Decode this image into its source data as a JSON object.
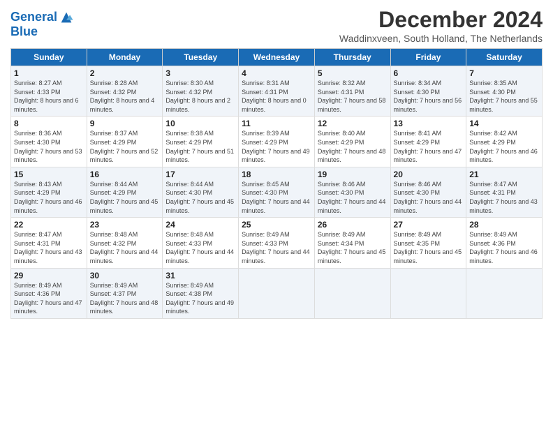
{
  "header": {
    "logo_line1": "General",
    "logo_line2": "Blue",
    "title": "December 2024",
    "subtitle": "Waddinxveen, South Holland, The Netherlands"
  },
  "columns": [
    "Sunday",
    "Monday",
    "Tuesday",
    "Wednesday",
    "Thursday",
    "Friday",
    "Saturday"
  ],
  "weeks": [
    [
      {
        "day": "1",
        "rise": "Sunrise: 8:27 AM",
        "set": "Sunset: 4:33 PM",
        "daylight": "Daylight: 8 hours and 6 minutes."
      },
      {
        "day": "2",
        "rise": "Sunrise: 8:28 AM",
        "set": "Sunset: 4:32 PM",
        "daylight": "Daylight: 8 hours and 4 minutes."
      },
      {
        "day": "3",
        "rise": "Sunrise: 8:30 AM",
        "set": "Sunset: 4:32 PM",
        "daylight": "Daylight: 8 hours and 2 minutes."
      },
      {
        "day": "4",
        "rise": "Sunrise: 8:31 AM",
        "set": "Sunset: 4:31 PM",
        "daylight": "Daylight: 8 hours and 0 minutes."
      },
      {
        "day": "5",
        "rise": "Sunrise: 8:32 AM",
        "set": "Sunset: 4:31 PM",
        "daylight": "Daylight: 7 hours and 58 minutes."
      },
      {
        "day": "6",
        "rise": "Sunrise: 8:34 AM",
        "set": "Sunset: 4:30 PM",
        "daylight": "Daylight: 7 hours and 56 minutes."
      },
      {
        "day": "7",
        "rise": "Sunrise: 8:35 AM",
        "set": "Sunset: 4:30 PM",
        "daylight": "Daylight: 7 hours and 55 minutes."
      }
    ],
    [
      {
        "day": "8",
        "rise": "Sunrise: 8:36 AM",
        "set": "Sunset: 4:30 PM",
        "daylight": "Daylight: 7 hours and 53 minutes."
      },
      {
        "day": "9",
        "rise": "Sunrise: 8:37 AM",
        "set": "Sunset: 4:29 PM",
        "daylight": "Daylight: 7 hours and 52 minutes."
      },
      {
        "day": "10",
        "rise": "Sunrise: 8:38 AM",
        "set": "Sunset: 4:29 PM",
        "daylight": "Daylight: 7 hours and 51 minutes."
      },
      {
        "day": "11",
        "rise": "Sunrise: 8:39 AM",
        "set": "Sunset: 4:29 PM",
        "daylight": "Daylight: 7 hours and 49 minutes."
      },
      {
        "day": "12",
        "rise": "Sunrise: 8:40 AM",
        "set": "Sunset: 4:29 PM",
        "daylight": "Daylight: 7 hours and 48 minutes."
      },
      {
        "day": "13",
        "rise": "Sunrise: 8:41 AM",
        "set": "Sunset: 4:29 PM",
        "daylight": "Daylight: 7 hours and 47 minutes."
      },
      {
        "day": "14",
        "rise": "Sunrise: 8:42 AM",
        "set": "Sunset: 4:29 PM",
        "daylight": "Daylight: 7 hours and 46 minutes."
      }
    ],
    [
      {
        "day": "15",
        "rise": "Sunrise: 8:43 AM",
        "set": "Sunset: 4:29 PM",
        "daylight": "Daylight: 7 hours and 46 minutes."
      },
      {
        "day": "16",
        "rise": "Sunrise: 8:44 AM",
        "set": "Sunset: 4:29 PM",
        "daylight": "Daylight: 7 hours and 45 minutes."
      },
      {
        "day": "17",
        "rise": "Sunrise: 8:44 AM",
        "set": "Sunset: 4:30 PM",
        "daylight": "Daylight: 7 hours and 45 minutes."
      },
      {
        "day": "18",
        "rise": "Sunrise: 8:45 AM",
        "set": "Sunset: 4:30 PM",
        "daylight": "Daylight: 7 hours and 44 minutes."
      },
      {
        "day": "19",
        "rise": "Sunrise: 8:46 AM",
        "set": "Sunset: 4:30 PM",
        "daylight": "Daylight: 7 hours and 44 minutes."
      },
      {
        "day": "20",
        "rise": "Sunrise: 8:46 AM",
        "set": "Sunset: 4:30 PM",
        "daylight": "Daylight: 7 hours and 44 minutes."
      },
      {
        "day": "21",
        "rise": "Sunrise: 8:47 AM",
        "set": "Sunset: 4:31 PM",
        "daylight": "Daylight: 7 hours and 43 minutes."
      }
    ],
    [
      {
        "day": "22",
        "rise": "Sunrise: 8:47 AM",
        "set": "Sunset: 4:31 PM",
        "daylight": "Daylight: 7 hours and 43 minutes."
      },
      {
        "day": "23",
        "rise": "Sunrise: 8:48 AM",
        "set": "Sunset: 4:32 PM",
        "daylight": "Daylight: 7 hours and 44 minutes."
      },
      {
        "day": "24",
        "rise": "Sunrise: 8:48 AM",
        "set": "Sunset: 4:33 PM",
        "daylight": "Daylight: 7 hours and 44 minutes."
      },
      {
        "day": "25",
        "rise": "Sunrise: 8:49 AM",
        "set": "Sunset: 4:33 PM",
        "daylight": "Daylight: 7 hours and 44 minutes."
      },
      {
        "day": "26",
        "rise": "Sunrise: 8:49 AM",
        "set": "Sunset: 4:34 PM",
        "daylight": "Daylight: 7 hours and 45 minutes."
      },
      {
        "day": "27",
        "rise": "Sunrise: 8:49 AM",
        "set": "Sunset: 4:35 PM",
        "daylight": "Daylight: 7 hours and 45 minutes."
      },
      {
        "day": "28",
        "rise": "Sunrise: 8:49 AM",
        "set": "Sunset: 4:36 PM",
        "daylight": "Daylight: 7 hours and 46 minutes."
      }
    ],
    [
      {
        "day": "29",
        "rise": "Sunrise: 8:49 AM",
        "set": "Sunset: 4:36 PM",
        "daylight": "Daylight: 7 hours and 47 minutes."
      },
      {
        "day": "30",
        "rise": "Sunrise: 8:49 AM",
        "set": "Sunset: 4:37 PM",
        "daylight": "Daylight: 7 hours and 48 minutes."
      },
      {
        "day": "31",
        "rise": "Sunrise: 8:49 AM",
        "set": "Sunset: 4:38 PM",
        "daylight": "Daylight: 7 hours and 49 minutes."
      },
      {
        "day": "",
        "rise": "",
        "set": "",
        "daylight": ""
      },
      {
        "day": "",
        "rise": "",
        "set": "",
        "daylight": ""
      },
      {
        "day": "",
        "rise": "",
        "set": "",
        "daylight": ""
      },
      {
        "day": "",
        "rise": "",
        "set": "",
        "daylight": ""
      }
    ]
  ]
}
